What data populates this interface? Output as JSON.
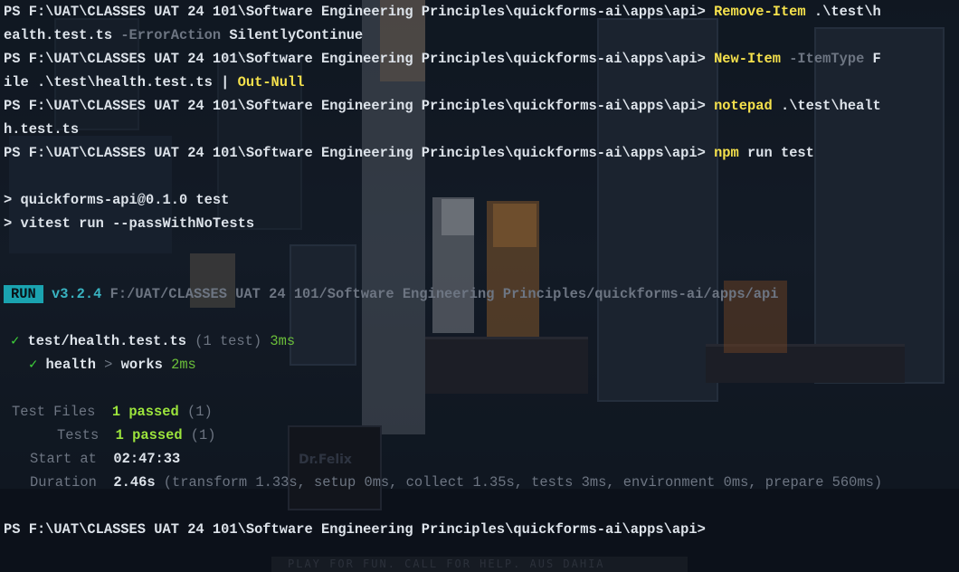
{
  "terminal": {
    "lines": {
      "l1_prompt": "PS F:\\UAT\\CLASSES UAT 24 101\\Software Engineering Principles\\quickforms-ai\\apps\\api> ",
      "l1_cmd": "Remove-Item",
      "l1_arg": " .\\test\\h",
      "l2_arg": "ealth.test.ts ",
      "l2_param": "-ErrorAction",
      "l2_val": " SilentlyContinue",
      "l3_prompt": "PS F:\\UAT\\CLASSES UAT 24 101\\Software Engineering Principles\\quickforms-ai\\apps\\api> ",
      "l3_cmd": "New-Item",
      "l3_param": " -ItemType",
      "l3_val": " F",
      "l4_arg": "ile .\\test\\health.test.ts | ",
      "l4_cmd": "Out-Null",
      "l5_prompt": "PS F:\\UAT\\CLASSES UAT 24 101\\Software Engineering Principles\\quickforms-ai\\apps\\api> ",
      "l5_cmd": "notepad",
      "l5_arg": " .\\test\\healt",
      "l6_arg": "h.test.ts",
      "l7_prompt": "PS F:\\UAT\\CLASSES UAT 24 101\\Software Engineering Principles\\quickforms-ai\\apps\\api> ",
      "l7_cmd": "npm",
      "l7_arg": " run test",
      "l8": "> quickforms-api@0.1.0 test",
      "l9": "> vitest run --passWithNoTests",
      "run_badge": "RUN",
      "run_version": "v3.2.4",
      "run_path": " F:/UAT/CLASSES UAT 24 101/Software Engineering Principles/quickforms-ai/apps/api",
      "file_check": "✓",
      "file_name": " test/health.test.ts",
      "file_count": " (1 test)",
      "file_time": " 3ms",
      "test_check": "✓",
      "test_suite": " health",
      "test_sep": " >",
      "test_name": " works",
      "test_time": " 2ms",
      "files_label": "Test Files",
      "files_value": "1 passed",
      "files_total": " (1)",
      "tests_label": "Tests",
      "tests_value": "1 passed",
      "tests_total": " (1)",
      "start_label": "Start at",
      "start_value": "02:47:33",
      "duration_label": "Duration",
      "duration_value": "2.46s",
      "duration_detail": " (transform 1.33s, setup 0ms, collect 1.35s, tests 3ms, environment 0ms, prepare 560ms)",
      "final_prompt": "PS F:\\UAT\\CLASSES UAT 24 101\\Software Engineering Principles\\quickforms-ai\\apps\\api>"
    }
  },
  "background": {
    "sign_text": "Dr.Felix",
    "bottom_text": "PLAY FOR FUN. CALL FOR HELP. AUS DAHIA"
  },
  "colors": {
    "command": "#f5e14c",
    "parameter": "#6d7582",
    "pass": "#9ce43c",
    "run_badge": "#1aa3b0",
    "version": "#39b3c1",
    "check": "#3fd43a"
  }
}
